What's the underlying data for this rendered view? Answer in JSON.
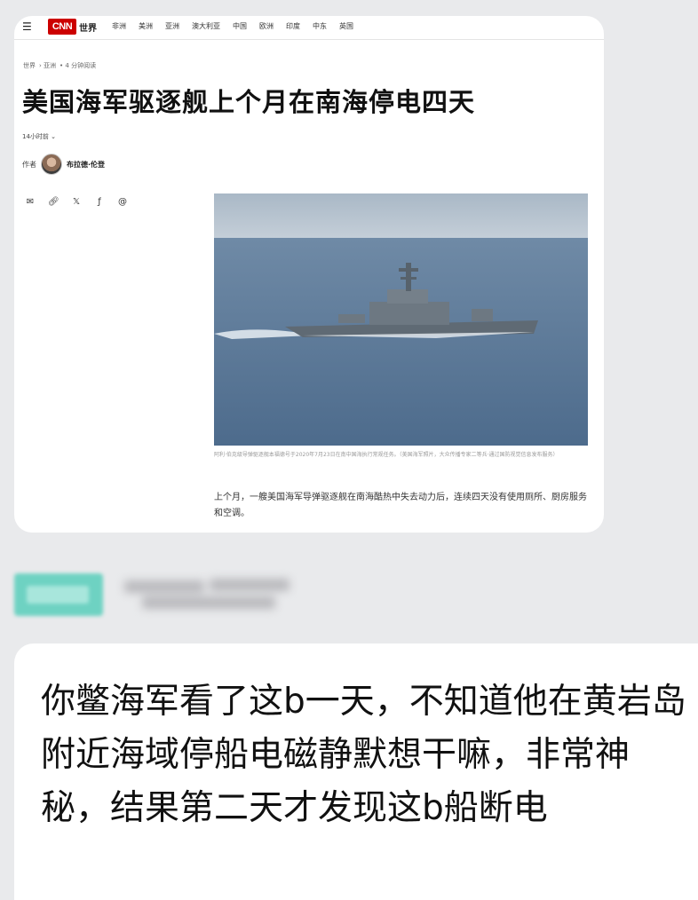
{
  "article": {
    "nav": {
      "menu_icon": "hamburger-menu-icon",
      "logo": "CNN",
      "edition": "世界",
      "links": [
        "非洲",
        "美洲",
        "亚洲",
        "澳大利亚",
        "中国",
        "欧洲",
        "印度",
        "中东",
        "英国"
      ]
    },
    "breadcrumb": [
      "世界",
      "亚洲",
      "4 分钟阅读"
    ],
    "headline": "美国海军驱逐舰上个月在南海停电四天",
    "updated": "14小时前",
    "byline": {
      "label": "作者",
      "author": "布拉德·伦登"
    },
    "share_icons": [
      "email-icon",
      "link-icon",
      "x-icon",
      "facebook-icon",
      "threads-icon"
    ],
    "caption": "阿利·伯克级导弹驱逐舰本福德号于2020年7月23日在南中国海执行常规任务。（美国海军照片，大众传播专家二等兵·通过国防视觉信息发布服务）",
    "lead": "上个月，一艘美国海军导弹驱逐舰在南海酷热中失去动力后，连续四天没有使用厕所、厨房服务和空调。"
  },
  "message": {
    "text": "你鳖海军看了这b一天，不知道他在黄岩岛附近海域停船电磁静默想干嘛，非常神秘，结果第二天才发现这b船断电"
  },
  "colors": {
    "cnn_red": "#cc0000",
    "chip_teal": "#6ed2c2",
    "page_bg": "#e9eaec"
  }
}
